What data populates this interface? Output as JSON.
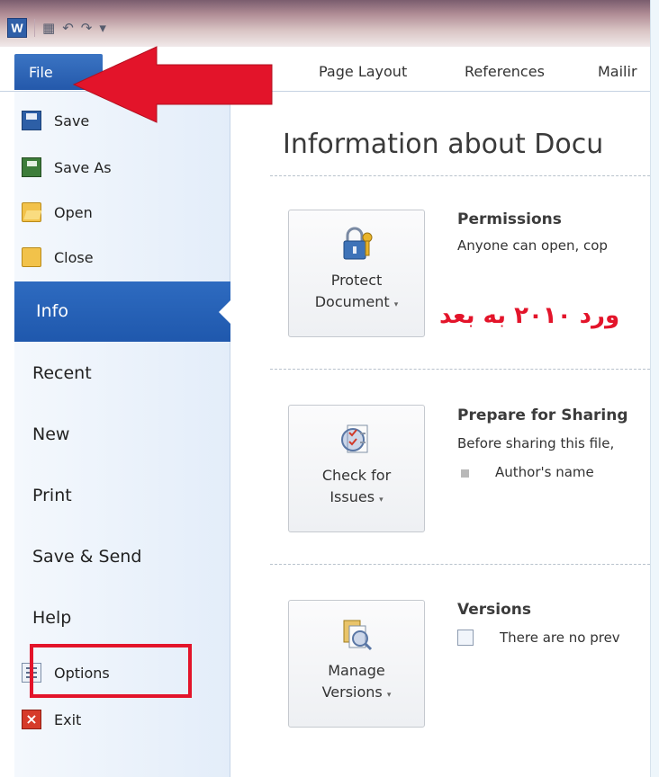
{
  "app": {
    "icon_label": "W",
    "qat_icons": [
      "save-icon",
      "undo-icon",
      "redo-icon"
    ]
  },
  "ribbon": {
    "file_tab": "File",
    "tabs": [
      "Page Layout",
      "References",
      "Mailir"
    ]
  },
  "menu": {
    "small_items": [
      {
        "label": "Save",
        "icon": "save-icon"
      },
      {
        "label": "Save As",
        "icon": "save-as-icon"
      },
      {
        "label": "Open",
        "icon": "open-folder-icon"
      },
      {
        "label": "Close",
        "icon": "close-folder-icon"
      }
    ],
    "selected": "Info",
    "big_items": [
      "Recent",
      "New",
      "Print",
      "Save & Send",
      "Help"
    ],
    "options": {
      "label": "Options",
      "icon": "options-icon"
    },
    "exit": {
      "label": "Exit",
      "icon": "exit-icon"
    }
  },
  "main": {
    "title": "Information about Docu",
    "sections": [
      {
        "button_line1": "Protect",
        "button_line2": "Document",
        "icon": "lock-key-icon",
        "heading": "Permissions",
        "text": "Anyone can open, cop"
      },
      {
        "button_line1": "Check for",
        "button_line2": "Issues",
        "icon": "checklist-icon",
        "heading": "Prepare for Sharing",
        "text": "Before sharing this file,",
        "bullet": "Author's name"
      },
      {
        "button_line1": "Manage",
        "button_line2": "Versions",
        "icon": "versions-icon",
        "heading": "Versions",
        "text": "There are no prev"
      }
    ],
    "annotation": "ورد ۲۰۱۰ به بعد"
  },
  "colors": {
    "accent": "#2459ab",
    "highlight_red": "#e3142a"
  }
}
